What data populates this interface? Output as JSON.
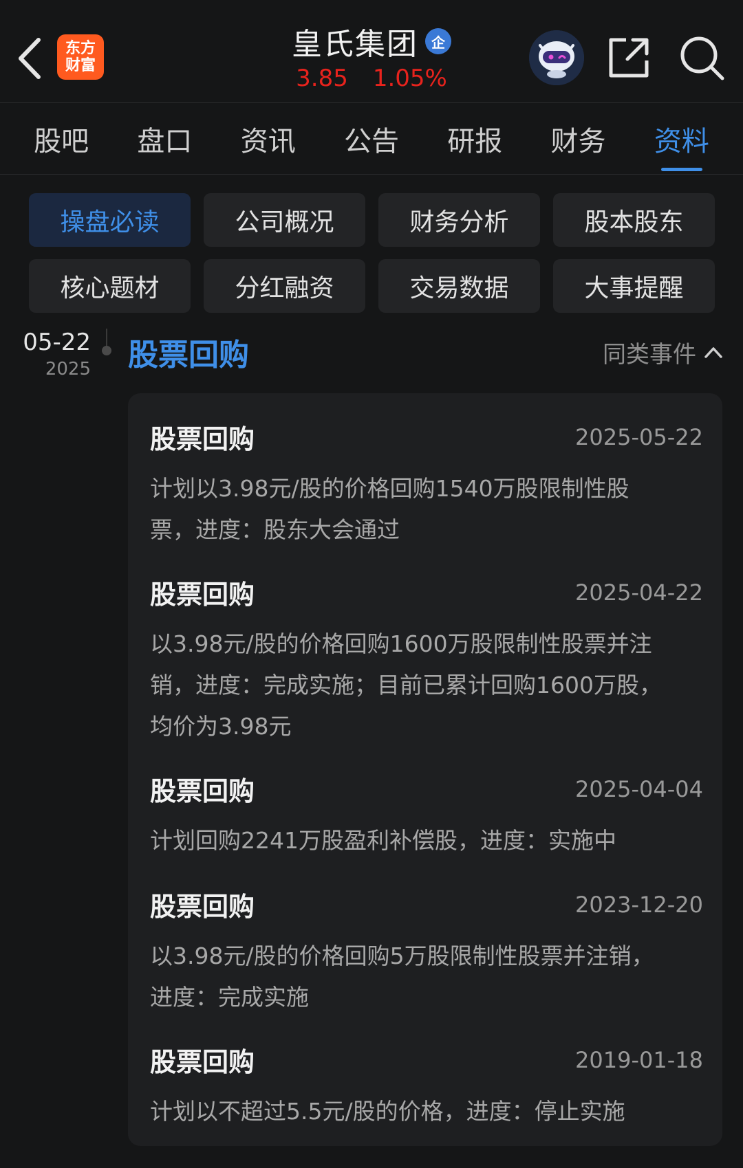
{
  "header": {
    "logo_line1": "东方",
    "logo_line2": "财富",
    "stock_name": "皇氏集团",
    "badge": "企",
    "price": "3.85",
    "change_pct": "1.05%"
  },
  "colors": {
    "accent": "#3f8fe8",
    "up": "#e8231d",
    "logo": "#ff5a1f"
  },
  "tabs": [
    {
      "label": "股吧"
    },
    {
      "label": "盘口"
    },
    {
      "label": "资讯"
    },
    {
      "label": "公告"
    },
    {
      "label": "研报"
    },
    {
      "label": "财务"
    },
    {
      "label": "资料",
      "active": true
    }
  ],
  "quick_grid": [
    {
      "label": "操盘必读",
      "active": true
    },
    {
      "label": "公司概况"
    },
    {
      "label": "财务分析"
    },
    {
      "label": "股本股东"
    },
    {
      "label": "核心题材"
    },
    {
      "label": "分红融资"
    },
    {
      "label": "交易数据"
    },
    {
      "label": "大事提醒"
    }
  ],
  "event": {
    "date_md": "05-22",
    "date_year": "2025",
    "title": "股票回购",
    "similar_label": "同类事件",
    "items": [
      {
        "title": "股票回购",
        "date": "2025-05-22",
        "lines": [
          "计划以3.98元/股的价格回购1540万股限制性股",
          "票，进度：股东大会通过"
        ]
      },
      {
        "title": "股票回购",
        "date": "2025-04-22",
        "lines": [
          "以3.98元/股的价格回购1600万股限制性股票并注",
          "销，进度：完成实施；目前已累计回购1600万股，",
          "均价为3.98元"
        ]
      },
      {
        "title": "股票回购",
        "date": "2025-04-04",
        "lines": [
          "计划回购2241万股盈利补偿股，进度：实施中"
        ]
      },
      {
        "title": "股票回购",
        "date": "2023-12-20",
        "lines": [
          "以3.98元/股的价格回购5万股限制性股票并注销，",
          "进度：完成实施"
        ]
      },
      {
        "title": "股票回购",
        "date": "2019-01-18",
        "lines": [
          "计划以不超过5.5元/股的价格，进度：停止实施"
        ]
      }
    ]
  },
  "icons": {
    "back": "chevron-left-icon",
    "share": "share-icon",
    "search": "search-icon",
    "assistant": "robot-avatar-icon",
    "collapse": "chevron-up-icon"
  }
}
